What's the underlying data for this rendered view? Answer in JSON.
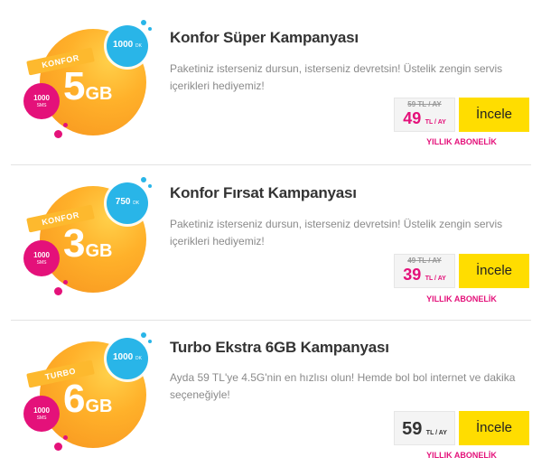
{
  "campaigns": [
    {
      "title": "Konfor Süper Kampanyası",
      "description": "Paketiniz isterseniz dursun, isterseniz devretsin! Üstelik zengin servis içerikleri hediyemiz!",
      "badge": {
        "label": "KONFOR",
        "gb_value": "5",
        "gb_unit": "GB",
        "minutes": "1000",
        "minutes_unit": "DK",
        "sms": "1000",
        "sms_unit": "SMS"
      },
      "old_price": "59 TL / AY",
      "price_value": "49",
      "price_unit": "TL / AY",
      "button_label": "İncele",
      "subscription_label": "YILLIK ABONELİK"
    },
    {
      "title": "Konfor Fırsat Kampanyası",
      "description": "Paketiniz isterseniz dursun, isterseniz devretsin! Üstelik zengin servis içerikleri hediyemiz!",
      "badge": {
        "label": "KONFOR",
        "gb_value": "3",
        "gb_unit": "GB",
        "minutes": "750",
        "minutes_unit": "DK",
        "sms": "1000",
        "sms_unit": "SMS"
      },
      "old_price": "49 TL / AY",
      "price_value": "39",
      "price_unit": "TL / AY",
      "button_label": "İncele",
      "subscription_label": "YILLIK ABONELİK"
    },
    {
      "title": "Turbo Ekstra 6GB Kampanyası",
      "description": "Ayda 59 TL'ye 4.5G'nin en hızlısı olun! Hemde bol bol internet ve dakika seçeneğiyle!",
      "badge": {
        "label": "TURBO",
        "gb_value": "6",
        "gb_unit": "GB",
        "minutes": "1000",
        "minutes_unit": "DK",
        "sms": "1000",
        "sms_unit": "SMS"
      },
      "price_value": "59",
      "price_unit": "TL / AY",
      "button_label": "İncele",
      "subscription_label": "YILLIK ABONELİK"
    }
  ],
  "colors": {
    "accent_pink": "#e4117a",
    "accent_yellow": "#ffdd00",
    "accent_orange": "#f7931e",
    "accent_blue": "#29b5e8"
  }
}
